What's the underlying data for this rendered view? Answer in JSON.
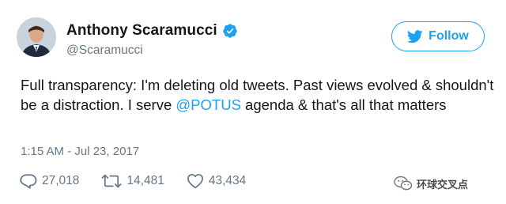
{
  "user": {
    "display_name": "Anthony Scaramucci",
    "handle": "@Scaramucci",
    "verified": true
  },
  "follow_button": {
    "label": "Follow",
    "icon": "twitter-bird-icon"
  },
  "tweet": {
    "text_before": "Full transparency: I'm deleting old tweets. Past views evolved & shouldn't be a distraction. I serve ",
    "mention": "@POTUS",
    "text_after": " agenda & that's all that matters",
    "timestamp": "1:15 AM - Jul 23, 2017"
  },
  "actions": {
    "replies": {
      "count": "27,018",
      "icon": "reply-icon"
    },
    "retweets": {
      "count": "14,481",
      "icon": "retweet-icon"
    },
    "likes": {
      "count": "43,434",
      "icon": "heart-icon"
    }
  },
  "watermark": {
    "text": "环球交叉点",
    "icon": "wechat-icon"
  },
  "colors": {
    "accent": "#1da1f2",
    "text": "#14171a",
    "secondary": "#657786"
  }
}
